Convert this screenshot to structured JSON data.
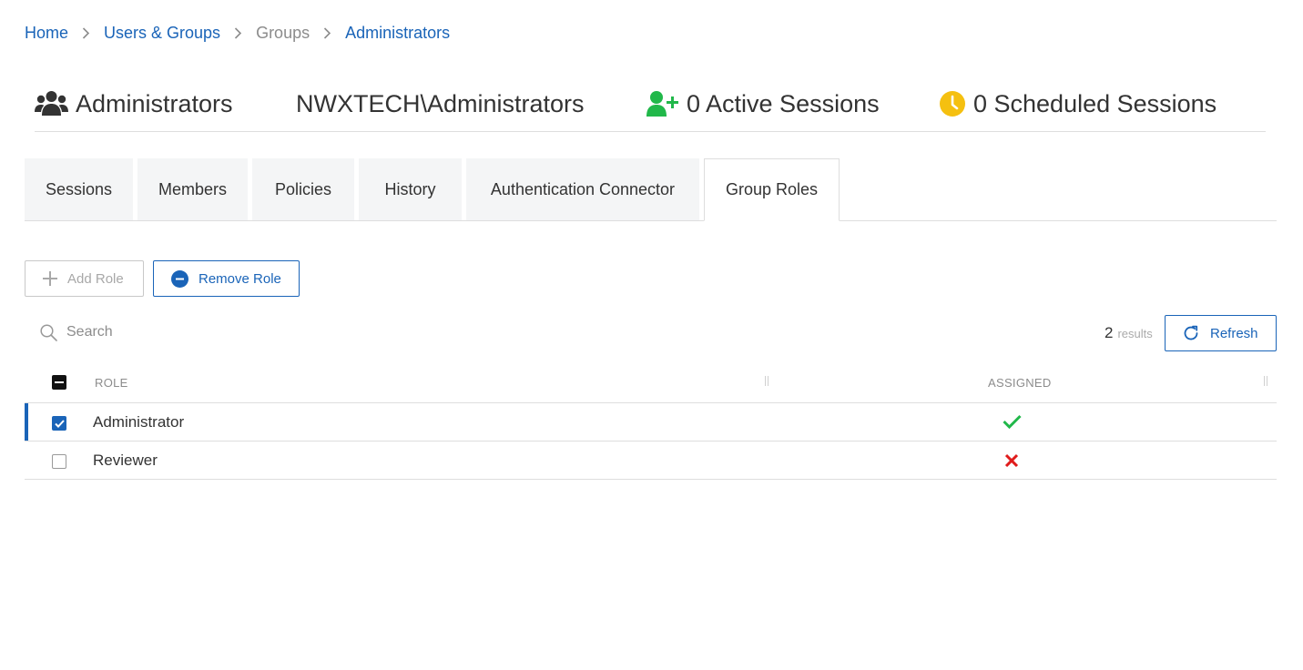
{
  "breadcrumb": {
    "home": "Home",
    "users_groups": "Users & Groups",
    "groups": "Groups",
    "current": "Administrators"
  },
  "header": {
    "group_name": "Administrators",
    "qualified_name": "NWXTECH\\Administrators",
    "active_sessions": "0 Active Sessions",
    "scheduled_sessions": "0 Scheduled Sessions"
  },
  "tabs": [
    {
      "label": "Sessions",
      "active": false
    },
    {
      "label": "Members",
      "active": false
    },
    {
      "label": "Policies",
      "active": false
    },
    {
      "label": "History",
      "active": false
    },
    {
      "label": "Authentication Connector",
      "active": false
    },
    {
      "label": "Group Roles",
      "active": true
    }
  ],
  "toolbar": {
    "add_role": "Add Role",
    "remove_role": "Remove Role",
    "refresh": "Refresh"
  },
  "search": {
    "placeholder": "Search"
  },
  "results": {
    "count": "2",
    "label": "results"
  },
  "table": {
    "columns": {
      "role": "ROLE",
      "assigned": "ASSIGNED"
    },
    "rows": [
      {
        "role": "Administrator",
        "checked": true,
        "assigned": true
      },
      {
        "role": "Reviewer",
        "checked": false,
        "assigned": false
      }
    ]
  },
  "colors": {
    "link": "#1a64b8",
    "success": "#21b84a",
    "danger": "#e01b1b",
    "warning": "#f5c010"
  },
  "icons": {
    "group": "users-icon",
    "active": "user-plus-icon",
    "scheduled": "clock-icon"
  }
}
